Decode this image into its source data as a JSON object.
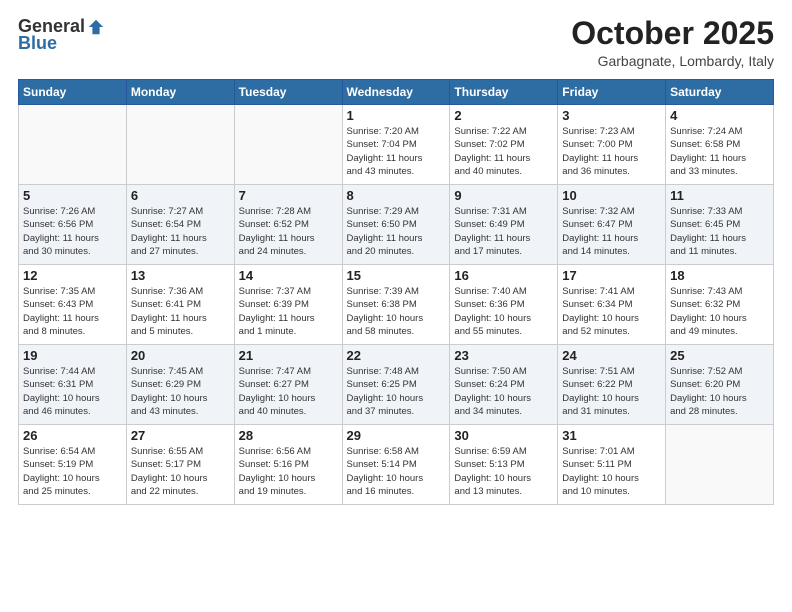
{
  "header": {
    "logo_general": "General",
    "logo_blue": "Blue",
    "month": "October 2025",
    "location": "Garbagnate, Lombardy, Italy"
  },
  "weekdays": [
    "Sunday",
    "Monday",
    "Tuesday",
    "Wednesday",
    "Thursday",
    "Friday",
    "Saturday"
  ],
  "weeks": [
    [
      {
        "day": "",
        "info": ""
      },
      {
        "day": "",
        "info": ""
      },
      {
        "day": "",
        "info": ""
      },
      {
        "day": "1",
        "info": "Sunrise: 7:20 AM\nSunset: 7:04 PM\nDaylight: 11 hours\nand 43 minutes."
      },
      {
        "day": "2",
        "info": "Sunrise: 7:22 AM\nSunset: 7:02 PM\nDaylight: 11 hours\nand 40 minutes."
      },
      {
        "day": "3",
        "info": "Sunrise: 7:23 AM\nSunset: 7:00 PM\nDaylight: 11 hours\nand 36 minutes."
      },
      {
        "day": "4",
        "info": "Sunrise: 7:24 AM\nSunset: 6:58 PM\nDaylight: 11 hours\nand 33 minutes."
      }
    ],
    [
      {
        "day": "5",
        "info": "Sunrise: 7:26 AM\nSunset: 6:56 PM\nDaylight: 11 hours\nand 30 minutes."
      },
      {
        "day": "6",
        "info": "Sunrise: 7:27 AM\nSunset: 6:54 PM\nDaylight: 11 hours\nand 27 minutes."
      },
      {
        "day": "7",
        "info": "Sunrise: 7:28 AM\nSunset: 6:52 PM\nDaylight: 11 hours\nand 24 minutes."
      },
      {
        "day": "8",
        "info": "Sunrise: 7:29 AM\nSunset: 6:50 PM\nDaylight: 11 hours\nand 20 minutes."
      },
      {
        "day": "9",
        "info": "Sunrise: 7:31 AM\nSunset: 6:49 PM\nDaylight: 11 hours\nand 17 minutes."
      },
      {
        "day": "10",
        "info": "Sunrise: 7:32 AM\nSunset: 6:47 PM\nDaylight: 11 hours\nand 14 minutes."
      },
      {
        "day": "11",
        "info": "Sunrise: 7:33 AM\nSunset: 6:45 PM\nDaylight: 11 hours\nand 11 minutes."
      }
    ],
    [
      {
        "day": "12",
        "info": "Sunrise: 7:35 AM\nSunset: 6:43 PM\nDaylight: 11 hours\nand 8 minutes."
      },
      {
        "day": "13",
        "info": "Sunrise: 7:36 AM\nSunset: 6:41 PM\nDaylight: 11 hours\nand 5 minutes."
      },
      {
        "day": "14",
        "info": "Sunrise: 7:37 AM\nSunset: 6:39 PM\nDaylight: 11 hours\nand 1 minute."
      },
      {
        "day": "15",
        "info": "Sunrise: 7:39 AM\nSunset: 6:38 PM\nDaylight: 10 hours\nand 58 minutes."
      },
      {
        "day": "16",
        "info": "Sunrise: 7:40 AM\nSunset: 6:36 PM\nDaylight: 10 hours\nand 55 minutes."
      },
      {
        "day": "17",
        "info": "Sunrise: 7:41 AM\nSunset: 6:34 PM\nDaylight: 10 hours\nand 52 minutes."
      },
      {
        "day": "18",
        "info": "Sunrise: 7:43 AM\nSunset: 6:32 PM\nDaylight: 10 hours\nand 49 minutes."
      }
    ],
    [
      {
        "day": "19",
        "info": "Sunrise: 7:44 AM\nSunset: 6:31 PM\nDaylight: 10 hours\nand 46 minutes."
      },
      {
        "day": "20",
        "info": "Sunrise: 7:45 AM\nSunset: 6:29 PM\nDaylight: 10 hours\nand 43 minutes."
      },
      {
        "day": "21",
        "info": "Sunrise: 7:47 AM\nSunset: 6:27 PM\nDaylight: 10 hours\nand 40 minutes."
      },
      {
        "day": "22",
        "info": "Sunrise: 7:48 AM\nSunset: 6:25 PM\nDaylight: 10 hours\nand 37 minutes."
      },
      {
        "day": "23",
        "info": "Sunrise: 7:50 AM\nSunset: 6:24 PM\nDaylight: 10 hours\nand 34 minutes."
      },
      {
        "day": "24",
        "info": "Sunrise: 7:51 AM\nSunset: 6:22 PM\nDaylight: 10 hours\nand 31 minutes."
      },
      {
        "day": "25",
        "info": "Sunrise: 7:52 AM\nSunset: 6:20 PM\nDaylight: 10 hours\nand 28 minutes."
      }
    ],
    [
      {
        "day": "26",
        "info": "Sunrise: 6:54 AM\nSunset: 5:19 PM\nDaylight: 10 hours\nand 25 minutes."
      },
      {
        "day": "27",
        "info": "Sunrise: 6:55 AM\nSunset: 5:17 PM\nDaylight: 10 hours\nand 22 minutes."
      },
      {
        "day": "28",
        "info": "Sunrise: 6:56 AM\nSunset: 5:16 PM\nDaylight: 10 hours\nand 19 minutes."
      },
      {
        "day": "29",
        "info": "Sunrise: 6:58 AM\nSunset: 5:14 PM\nDaylight: 10 hours\nand 16 minutes."
      },
      {
        "day": "30",
        "info": "Sunrise: 6:59 AM\nSunset: 5:13 PM\nDaylight: 10 hours\nand 13 minutes."
      },
      {
        "day": "31",
        "info": "Sunrise: 7:01 AM\nSunset: 5:11 PM\nDaylight: 10 hours\nand 10 minutes."
      },
      {
        "day": "",
        "info": ""
      }
    ]
  ]
}
